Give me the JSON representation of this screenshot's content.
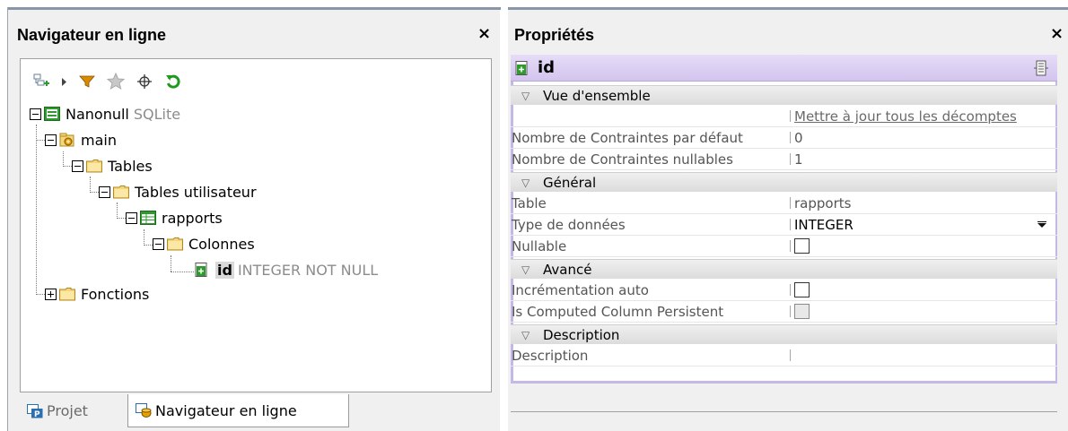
{
  "navigator": {
    "title": "Navigateur en ligne",
    "close_label": "×",
    "toolbar": {
      "icons": [
        "add-object-icon",
        "dropdown-arrow-icon",
        "filter-icon",
        "favorites-icon",
        "crosshair-icon",
        "refresh-icon"
      ]
    },
    "tree": {
      "connection": {
        "name": "Nanonull",
        "type": "SQLite"
      },
      "schema": "main",
      "tables_folder": "Tables",
      "user_tables_folder": "Tables utilisateur",
      "table": "rapports",
      "columns_folder": "Colonnes",
      "column": {
        "name": "id",
        "type": "INTEGER NOT NULL"
      },
      "functions_folder": "Fonctions"
    },
    "tabs": [
      {
        "label": "Projet",
        "active": false
      },
      {
        "label": "Navigateur en ligne",
        "active": true
      }
    ]
  },
  "properties": {
    "title": "Propriétés",
    "close_label": "×",
    "object_name": "id",
    "sections": {
      "overview": {
        "label": "Vue d'ensemble",
        "update_link": "Mettre à jour tous les décomptes",
        "rows": [
          {
            "name": "Nombre de Contraintes par défaut",
            "value": "0"
          },
          {
            "name": "Nombre de Contraintes nullables",
            "value": "1"
          }
        ]
      },
      "general": {
        "label": "Général",
        "table_label": "Table",
        "table_value": "rapports",
        "datatype_label": "Type de données",
        "datatype_value": "INTEGER",
        "nullable_label": "Nullable",
        "nullable_checked": false
      },
      "advanced": {
        "label": "Avancé",
        "autoinc_label": "Incrémentation auto",
        "autoinc_checked": false,
        "computed_label": "Is Computed Column Persistent",
        "computed_checked": false
      },
      "description": {
        "label": "Description",
        "desc_label": "Description",
        "desc_value": ""
      }
    }
  },
  "colors": {
    "object_header": "#d3c4ee",
    "folder": "#f5d77a",
    "table_icon": "#2e9b2e",
    "refresh": "#1e9a1e"
  }
}
